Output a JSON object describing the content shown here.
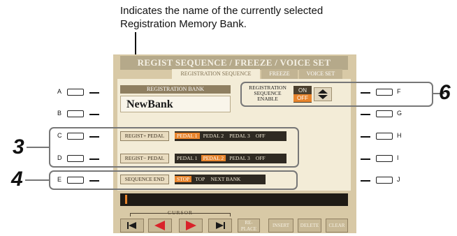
{
  "caption": {
    "line1": "Indicates the name of the currently selected",
    "line2": "Registration Memory Bank."
  },
  "screen": {
    "title": "REGIST SEQUENCE / FREEZE / VOICE SET",
    "tabs": [
      "REGISTRATION SEQUENCE",
      "FREEZE",
      "VOICE SET"
    ],
    "bank_label": "REGISTRATION BANK",
    "bank_name": "NewBank",
    "sequence_enable": {
      "label_line1": "REGISTRATION",
      "label_line2": "SEQUENCE",
      "label_line3": "ENABLE",
      "on": "ON",
      "off": "OFF",
      "selected": "OFF"
    },
    "regist_plus": {
      "label": "REGIST+ PEDAL",
      "options": [
        "PEDAL 1",
        "PEDAL 2",
        "PEDAL 3",
        "OFF"
      ],
      "selected": "PEDAL 1"
    },
    "regist_minus": {
      "label": "REGIST− PEDAL",
      "options": [
        "PEDAL 1",
        "PEDAL 2",
        "PEDAL 3",
        "OFF"
      ],
      "selected": "PEDAL 2"
    },
    "sequence_end": {
      "label": "SEQUENCE END",
      "options": [
        "STOP",
        "TOP",
        "NEXT BANK"
      ],
      "selected": "STOP"
    },
    "cursor_label": "CURSOR",
    "bottom_buttons": [
      "RE-PLACE",
      "INSERT",
      "DELETE",
      "CLEAR"
    ]
  },
  "panel_buttons": {
    "left": [
      "A",
      "B",
      "C",
      "D",
      "E"
    ],
    "right": [
      "F",
      "G",
      "H",
      "I",
      "J"
    ]
  },
  "callouts": [
    "3",
    "4",
    "6"
  ],
  "colors": {
    "accent": "#e7842c",
    "screen_bg": "#d8c9a6",
    "content_bg": "#f3ecd7"
  }
}
